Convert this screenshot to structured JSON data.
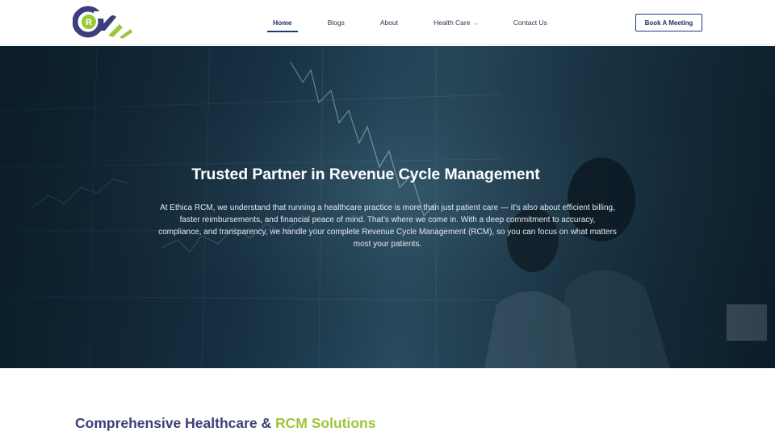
{
  "header": {
    "logo_letter": "R",
    "nav": [
      {
        "label": "Home",
        "active": true
      },
      {
        "label": "Blogs",
        "active": false
      },
      {
        "label": "About",
        "active": false
      },
      {
        "label": "Health Care",
        "active": false,
        "has_dropdown": true
      },
      {
        "label": "Contact Us",
        "active": false
      }
    ],
    "dropdown_icon": "chevron-down-icon",
    "cta_label": "Book A Meeting"
  },
  "hero": {
    "title": "Trusted Partner in Revenue Cycle Management",
    "body": "At Ethica RCM, we understand that running a healthcare practice is more than just patient care — it’s also about efficient billing, faster reimbursements, and financial peace of mind. That’s where we come in. With a deep commitment to accuracy, compliance, and transparency, we handle your complete Revenue Cycle Management (RCM), so you can focus on what matters most your patients."
  },
  "section": {
    "title_part1": "Comprehensive Healthcare & ",
    "title_part2": "RCM Solutions"
  },
  "colors": {
    "brand_navy": "#3c3f7a",
    "brand_green": "#9dc73a",
    "cta_border": "#1c3c78"
  }
}
